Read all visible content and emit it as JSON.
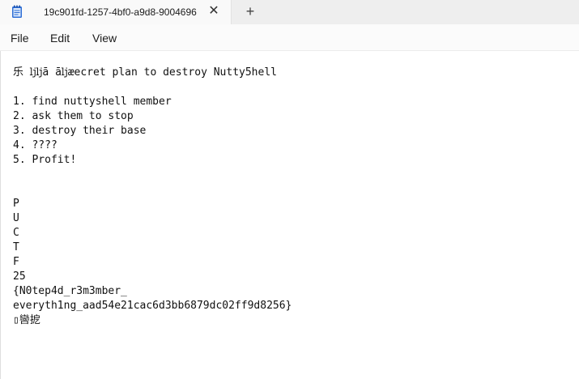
{
  "tab": {
    "icon": "notepad-icon",
    "title": "19c901fd-1257-4bf0-a9d8-9004696",
    "close_glyph": "✕",
    "new_tab_glyph": "+"
  },
  "menu": {
    "file": "File",
    "edit": "Edit",
    "view": "View"
  },
  "document": {
    "lines": [
      "乐 ǉǉā āǉæecret plan to destroy Nutty5hell",
      "",
      "1. find nuttyshell member",
      "2. ask them to stop",
      "3. destroy their base",
      "4. ????",
      "5. Profit!",
      "",
      "",
      "P",
      "U",
      "C",
      "T",
      "F",
      "25",
      "{N0tep4d_r3m3mber_",
      "everyth1ng_aad54e21cac6d3bb6879dc02ff9d8256}",
      "▯㘘㧖"
    ]
  }
}
